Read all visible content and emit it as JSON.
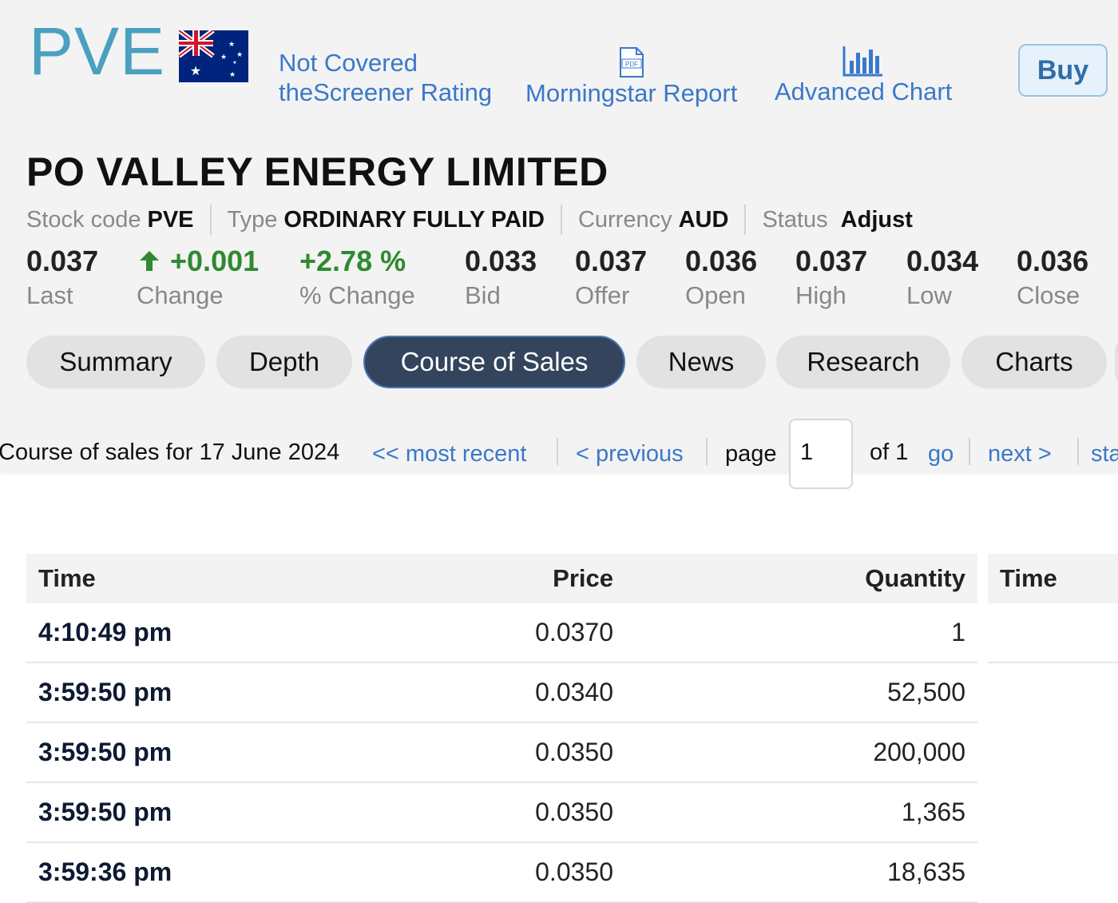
{
  "header": {
    "ticker": "PVE",
    "rating_line1": "Not Covered",
    "rating_line2": "theScreener Rating",
    "morningstar": "Morningstar Report",
    "advanced_chart": "Advanced Chart",
    "buy": "Buy",
    "pdf_badge": "PDF"
  },
  "company": {
    "name": "PO VALLEY ENERGY LIMITED",
    "stock_code_label": "Stock code",
    "stock_code": "PVE",
    "type_label": "Type",
    "type": "ORDINARY FULLY PAID",
    "currency_label": "Currency",
    "currency": "AUD",
    "status_label": "Status",
    "status": "Adjust"
  },
  "quote": {
    "last": "0.037",
    "last_label": "Last",
    "change": "+0.001",
    "change_label": "Change",
    "pct_change": "+2.78 %",
    "pct_change_label": "% Change",
    "bid": "0.033",
    "bid_label": "Bid",
    "offer": "0.037",
    "offer_label": "Offer",
    "open": "0.036",
    "open_label": "Open",
    "high": "0.037",
    "high_label": "High",
    "low": "0.034",
    "low_label": "Low",
    "close": "0.036",
    "close_label": "Close",
    "up_color": "#2f8a2f"
  },
  "tabs": [
    "Summary",
    "Depth",
    "Course of Sales",
    "News",
    "Research",
    "Charts"
  ],
  "active_tab": "Course of Sales",
  "pager": {
    "title": "Course of sales for 17 June 2024",
    "most_recent": "<< most recent",
    "previous": "< previous",
    "page_label": "page",
    "page_value": "1",
    "of_label": "of 1",
    "go": "go",
    "next": "next >",
    "start_partial": "sta"
  },
  "table": {
    "headers": {
      "time": "Time",
      "price": "Price",
      "quantity": "Quantity"
    },
    "rows": [
      {
        "time": "4:10:49 pm",
        "price": "0.0370",
        "quantity": "1"
      },
      {
        "time": "3:59:50 pm",
        "price": "0.0340",
        "quantity": "52,500"
      },
      {
        "time": "3:59:50 pm",
        "price": "0.0350",
        "quantity": "200,000"
      },
      {
        "time": "3:59:50 pm",
        "price": "0.0350",
        "quantity": "1,365"
      },
      {
        "time": "3:59:36 pm",
        "price": "0.0350",
        "quantity": "18,635"
      }
    ],
    "second_header_time": "Time"
  }
}
